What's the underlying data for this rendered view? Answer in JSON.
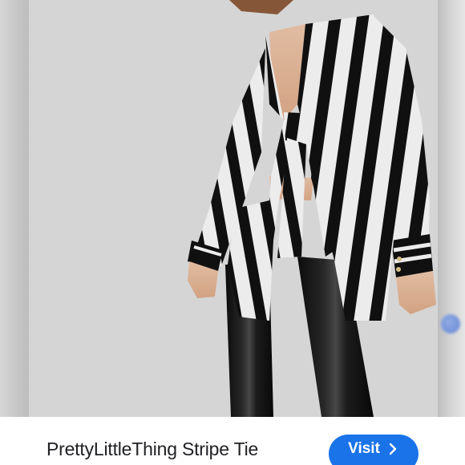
{
  "product": {
    "title": "PrettyLittleThing Stripe Tie",
    "image_description": "Model wearing black and white vertical stripe tie-front blouse with black leather leggings"
  },
  "actions": {
    "visit_label": "Visit",
    "visit_icon": "chevron-right-icon"
  },
  "colors": {
    "button_blue": "#1a73e8",
    "title_text": "#202124",
    "stripe_black": "#111111",
    "stripe_white": "#f4f4f4",
    "backdrop_grey": "#dcdcdc"
  }
}
